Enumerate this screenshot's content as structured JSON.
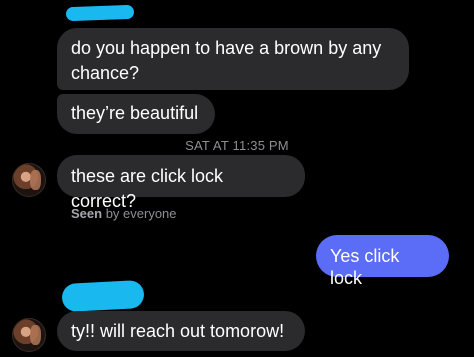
{
  "messages": {
    "m1_line1": "do you happen to have a brown by any",
    "m1_line2": "chance?",
    "m2": "they’re beautiful",
    "timestamp": "SAT AT 11:35 PM",
    "m3": "these are click lock correct?",
    "seen_label": "Seen",
    "seen_rest": " by everyone",
    "m4_outgoing": "Yes click lock",
    "m5": "ty!! will reach out tomorow!"
  },
  "colors": {
    "background": "#000000",
    "incoming_bubble": "#2b2b2d",
    "outgoing_bubble": "#5b6cf7",
    "redaction": "#19b8ee"
  },
  "icons": {
    "avatar_1": "user-avatar",
    "avatar_2": "user-avatar"
  }
}
